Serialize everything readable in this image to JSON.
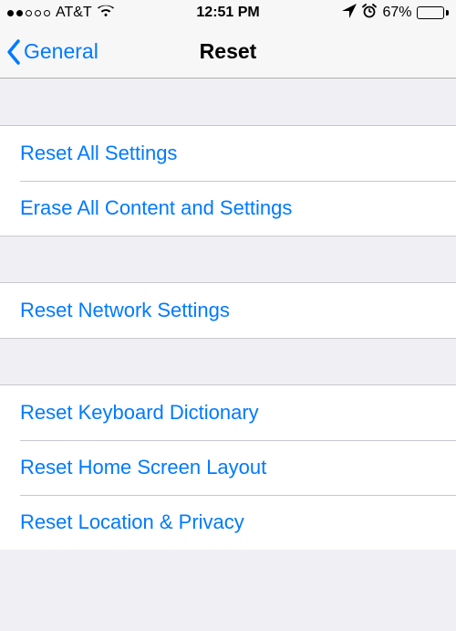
{
  "status": {
    "carrier": "AT&T",
    "time": "12:51 PM",
    "battery_pct": "67%"
  },
  "nav": {
    "back_label": "General",
    "title": "Reset"
  },
  "groups": {
    "g1": {
      "reset_all": "Reset All Settings",
      "erase_all": "Erase All Content and Settings"
    },
    "g2": {
      "reset_network": "Reset Network Settings"
    },
    "g3": {
      "reset_keyboard": "Reset Keyboard Dictionary",
      "reset_home": "Reset Home Screen Layout",
      "reset_location": "Reset Location & Privacy"
    }
  }
}
